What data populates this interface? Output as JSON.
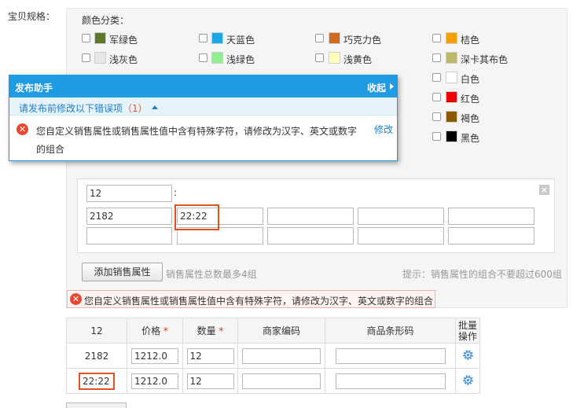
{
  "spec_label": "宝贝规格：",
  "color_section": {
    "title": "颜色分类：",
    "colors": [
      {
        "label": "军绿色",
        "color": "#5d7a2c"
      },
      {
        "label": "天蓝色",
        "color": "#1ea7e8"
      },
      {
        "label": "巧克力色",
        "color": "#d2691e"
      },
      {
        "label": "桔色",
        "color": "#f5a000"
      },
      {
        "label": "浅灰色",
        "color": "#e6e6e6"
      },
      {
        "label": "浅绿色",
        "color": "#90ee90"
      },
      {
        "label": "浅黄色",
        "color": "#ffffb8"
      },
      {
        "label": "深卡其布色",
        "color": "#bdb76b"
      },
      {
        "label": "白色",
        "color": "#ffffff"
      },
      {
        "label": "红色",
        "color": "#ee0000"
      },
      {
        "label": "褐色",
        "color": "#8b5a00"
      },
      {
        "label": "黑色",
        "color": "#000000"
      }
    ]
  },
  "popup": {
    "title": "发布助手",
    "collapse_label": "收起",
    "subtitle": "请发布前修改以下错误项",
    "count": "（1）",
    "message": "您自定义销售属性或销售属性值中含有特殊字符，请修改为汉字、英文或数字的组合",
    "fix_label": "修改"
  },
  "attribute": {
    "name_value": "12",
    "colon": ":",
    "values": [
      "2182",
      "22:22",
      "",
      "",
      "",
      "",
      "",
      "",
      "",
      ""
    ]
  },
  "add_attr_button": "添加销售属性",
  "attr_limit_note": "销售属性总数最多4组",
  "combination_hint": "提示：销售属性的组合不要超过600组",
  "error_banner": "您自定义销售属性或销售属性值中含有特殊字符，请修改为汉字、英文或数字的组合",
  "table": {
    "headers": {
      "attr": "12",
      "price": "价格",
      "qty": "数量",
      "required_mark": "*",
      "merchant_code": "商家编码",
      "barcode": "商品条形码",
      "batch": "批量操作"
    },
    "rows": [
      {
        "attr": "2182",
        "price": "1212.0",
        "qty": "12",
        "merchant_code": "",
        "barcode": ""
      },
      {
        "attr": "22:22",
        "price": "1212.0",
        "qty": "12",
        "merchant_code": "",
        "barcode": ""
      }
    ]
  },
  "accent_color": "#1e9be2",
  "error_color": "#e8492e"
}
